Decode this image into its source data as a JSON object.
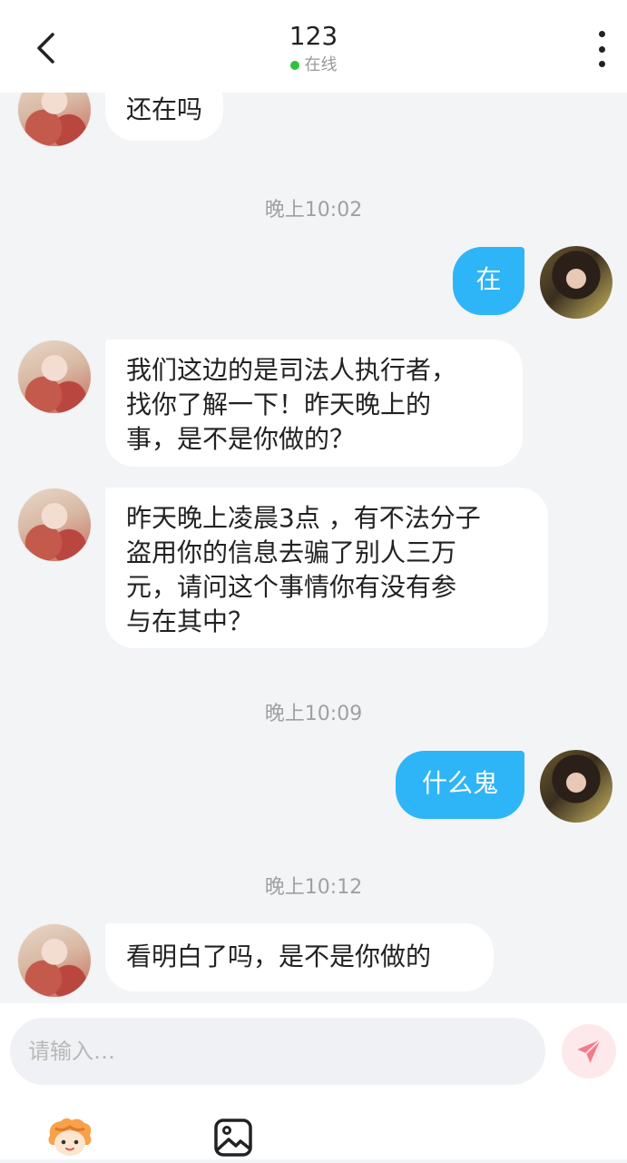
{
  "header": {
    "title": "123",
    "status": "在线",
    "status_color": "#2fc13f"
  },
  "messages": [
    {
      "type": "text",
      "side": "in",
      "text": "还在吗"
    },
    {
      "type": "time",
      "text": "晚上10:02"
    },
    {
      "type": "text",
      "side": "out",
      "text": "在"
    },
    {
      "type": "text",
      "side": "in",
      "lines": [
        "我们这边的是司法人执行者，",
        "找你了解一下！昨天晚上的",
        "事，是不是你做的？"
      ]
    },
    {
      "type": "text",
      "side": "in",
      "lines": [
        "昨天晚上凌晨3点 ，有不法分子",
        "盗用你的信息去骗了别人三万",
        "元，请问这个事情你有没有参",
        "与在其中？"
      ]
    },
    {
      "type": "time",
      "text": "晚上10:09"
    },
    {
      "type": "text",
      "side": "out",
      "text": "什么鬼"
    },
    {
      "type": "time",
      "text": "晚上10:12"
    },
    {
      "type": "text",
      "side": "in",
      "text": "看明白了吗，是不是你做的"
    }
  ],
  "composer": {
    "placeholder": "请输入…",
    "value": ""
  },
  "toolbar": {
    "items": [
      "sticker-icon",
      "image-icon"
    ]
  },
  "colors": {
    "out_bubble": "#2eb5f7",
    "in_bubble": "#ffffff",
    "background": "#f3f4f6",
    "send_button": "#f47b8b"
  }
}
